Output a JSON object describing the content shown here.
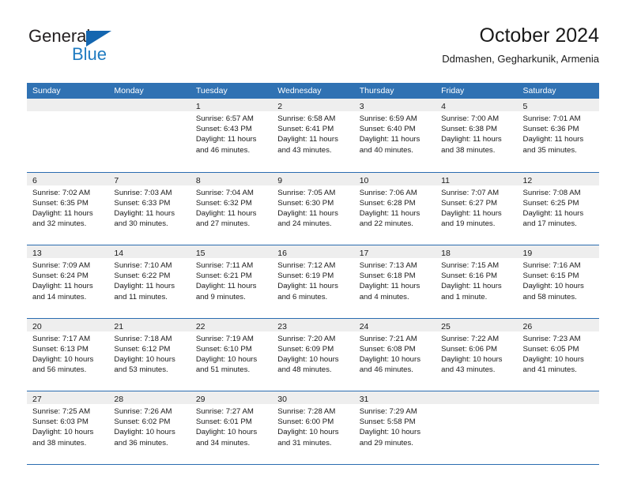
{
  "brand": {
    "name_top": "General",
    "name_bottom": "Blue",
    "triangle_color": "#1466b0",
    "blue_color": "#1f7bc1"
  },
  "header": {
    "title": "October 2024",
    "subtitle": "Ddmashen, Gegharkunik, Armenia"
  },
  "theme": {
    "header_blue": "#3072b3",
    "rule_blue": "#2a6cb0",
    "daynum_band": "#eeeeee"
  },
  "weekdays": [
    "Sunday",
    "Monday",
    "Tuesday",
    "Wednesday",
    "Thursday",
    "Friday",
    "Saturday"
  ],
  "weeks": [
    [
      {
        "day": "",
        "sunrise": "",
        "sunset": "",
        "daylight_1": "",
        "daylight_2": ""
      },
      {
        "day": "",
        "sunrise": "",
        "sunset": "",
        "daylight_1": "",
        "daylight_2": ""
      },
      {
        "day": "1",
        "sunrise": "Sunrise: 6:57 AM",
        "sunset": "Sunset: 6:43 PM",
        "daylight_1": "Daylight: 11 hours",
        "daylight_2": "and 46 minutes."
      },
      {
        "day": "2",
        "sunrise": "Sunrise: 6:58 AM",
        "sunset": "Sunset: 6:41 PM",
        "daylight_1": "Daylight: 11 hours",
        "daylight_2": "and 43 minutes."
      },
      {
        "day": "3",
        "sunrise": "Sunrise: 6:59 AM",
        "sunset": "Sunset: 6:40 PM",
        "daylight_1": "Daylight: 11 hours",
        "daylight_2": "and 40 minutes."
      },
      {
        "day": "4",
        "sunrise": "Sunrise: 7:00 AM",
        "sunset": "Sunset: 6:38 PM",
        "daylight_1": "Daylight: 11 hours",
        "daylight_2": "and 38 minutes."
      },
      {
        "day": "5",
        "sunrise": "Sunrise: 7:01 AM",
        "sunset": "Sunset: 6:36 PM",
        "daylight_1": "Daylight: 11 hours",
        "daylight_2": "and 35 minutes."
      }
    ],
    [
      {
        "day": "6",
        "sunrise": "Sunrise: 7:02 AM",
        "sunset": "Sunset: 6:35 PM",
        "daylight_1": "Daylight: 11 hours",
        "daylight_2": "and 32 minutes."
      },
      {
        "day": "7",
        "sunrise": "Sunrise: 7:03 AM",
        "sunset": "Sunset: 6:33 PM",
        "daylight_1": "Daylight: 11 hours",
        "daylight_2": "and 30 minutes."
      },
      {
        "day": "8",
        "sunrise": "Sunrise: 7:04 AM",
        "sunset": "Sunset: 6:32 PM",
        "daylight_1": "Daylight: 11 hours",
        "daylight_2": "and 27 minutes."
      },
      {
        "day": "9",
        "sunrise": "Sunrise: 7:05 AM",
        "sunset": "Sunset: 6:30 PM",
        "daylight_1": "Daylight: 11 hours",
        "daylight_2": "and 24 minutes."
      },
      {
        "day": "10",
        "sunrise": "Sunrise: 7:06 AM",
        "sunset": "Sunset: 6:28 PM",
        "daylight_1": "Daylight: 11 hours",
        "daylight_2": "and 22 minutes."
      },
      {
        "day": "11",
        "sunrise": "Sunrise: 7:07 AM",
        "sunset": "Sunset: 6:27 PM",
        "daylight_1": "Daylight: 11 hours",
        "daylight_2": "and 19 minutes."
      },
      {
        "day": "12",
        "sunrise": "Sunrise: 7:08 AM",
        "sunset": "Sunset: 6:25 PM",
        "daylight_1": "Daylight: 11 hours",
        "daylight_2": "and 17 minutes."
      }
    ],
    [
      {
        "day": "13",
        "sunrise": "Sunrise: 7:09 AM",
        "sunset": "Sunset: 6:24 PM",
        "daylight_1": "Daylight: 11 hours",
        "daylight_2": "and 14 minutes."
      },
      {
        "day": "14",
        "sunrise": "Sunrise: 7:10 AM",
        "sunset": "Sunset: 6:22 PM",
        "daylight_1": "Daylight: 11 hours",
        "daylight_2": "and 11 minutes."
      },
      {
        "day": "15",
        "sunrise": "Sunrise: 7:11 AM",
        "sunset": "Sunset: 6:21 PM",
        "daylight_1": "Daylight: 11 hours",
        "daylight_2": "and 9 minutes."
      },
      {
        "day": "16",
        "sunrise": "Sunrise: 7:12 AM",
        "sunset": "Sunset: 6:19 PM",
        "daylight_1": "Daylight: 11 hours",
        "daylight_2": "and 6 minutes."
      },
      {
        "day": "17",
        "sunrise": "Sunrise: 7:13 AM",
        "sunset": "Sunset: 6:18 PM",
        "daylight_1": "Daylight: 11 hours",
        "daylight_2": "and 4 minutes."
      },
      {
        "day": "18",
        "sunrise": "Sunrise: 7:15 AM",
        "sunset": "Sunset: 6:16 PM",
        "daylight_1": "Daylight: 11 hours",
        "daylight_2": "and 1 minute."
      },
      {
        "day": "19",
        "sunrise": "Sunrise: 7:16 AM",
        "sunset": "Sunset: 6:15 PM",
        "daylight_1": "Daylight: 10 hours",
        "daylight_2": "and 58 minutes."
      }
    ],
    [
      {
        "day": "20",
        "sunrise": "Sunrise: 7:17 AM",
        "sunset": "Sunset: 6:13 PM",
        "daylight_1": "Daylight: 10 hours",
        "daylight_2": "and 56 minutes."
      },
      {
        "day": "21",
        "sunrise": "Sunrise: 7:18 AM",
        "sunset": "Sunset: 6:12 PM",
        "daylight_1": "Daylight: 10 hours",
        "daylight_2": "and 53 minutes."
      },
      {
        "day": "22",
        "sunrise": "Sunrise: 7:19 AM",
        "sunset": "Sunset: 6:10 PM",
        "daylight_1": "Daylight: 10 hours",
        "daylight_2": "and 51 minutes."
      },
      {
        "day": "23",
        "sunrise": "Sunrise: 7:20 AM",
        "sunset": "Sunset: 6:09 PM",
        "daylight_1": "Daylight: 10 hours",
        "daylight_2": "and 48 minutes."
      },
      {
        "day": "24",
        "sunrise": "Sunrise: 7:21 AM",
        "sunset": "Sunset: 6:08 PM",
        "daylight_1": "Daylight: 10 hours",
        "daylight_2": "and 46 minutes."
      },
      {
        "day": "25",
        "sunrise": "Sunrise: 7:22 AM",
        "sunset": "Sunset: 6:06 PM",
        "daylight_1": "Daylight: 10 hours",
        "daylight_2": "and 43 minutes."
      },
      {
        "day": "26",
        "sunrise": "Sunrise: 7:23 AM",
        "sunset": "Sunset: 6:05 PM",
        "daylight_1": "Daylight: 10 hours",
        "daylight_2": "and 41 minutes."
      }
    ],
    [
      {
        "day": "27",
        "sunrise": "Sunrise: 7:25 AM",
        "sunset": "Sunset: 6:03 PM",
        "daylight_1": "Daylight: 10 hours",
        "daylight_2": "and 38 minutes."
      },
      {
        "day": "28",
        "sunrise": "Sunrise: 7:26 AM",
        "sunset": "Sunset: 6:02 PM",
        "daylight_1": "Daylight: 10 hours",
        "daylight_2": "and 36 minutes."
      },
      {
        "day": "29",
        "sunrise": "Sunrise: 7:27 AM",
        "sunset": "Sunset: 6:01 PM",
        "daylight_1": "Daylight: 10 hours",
        "daylight_2": "and 34 minutes."
      },
      {
        "day": "30",
        "sunrise": "Sunrise: 7:28 AM",
        "sunset": "Sunset: 6:00 PM",
        "daylight_1": "Daylight: 10 hours",
        "daylight_2": "and 31 minutes."
      },
      {
        "day": "31",
        "sunrise": "Sunrise: 7:29 AM",
        "sunset": "Sunset: 5:58 PM",
        "daylight_1": "Daylight: 10 hours",
        "daylight_2": "and 29 minutes."
      },
      {
        "day": "",
        "sunrise": "",
        "sunset": "",
        "daylight_1": "",
        "daylight_2": ""
      },
      {
        "day": "",
        "sunrise": "",
        "sunset": "",
        "daylight_1": "",
        "daylight_2": ""
      }
    ]
  ]
}
